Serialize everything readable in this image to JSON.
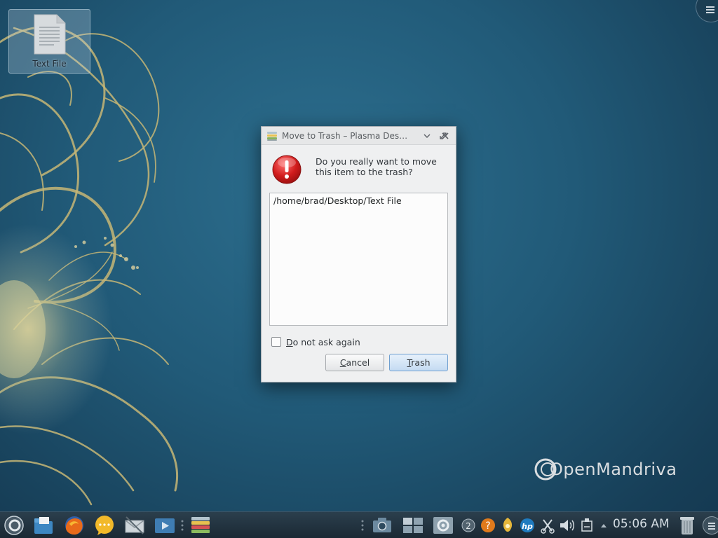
{
  "desktop": {
    "icons": [
      {
        "label": "Text File",
        "icon": "text-file-icon"
      }
    ],
    "brand": "OpenMandriva",
    "colors": {
      "background": "#215a78",
      "flourish": "#c9b97d"
    }
  },
  "dialog": {
    "title": "Move to Trash – Plasma Des…",
    "question": "Do you really want to move this item to the trash?",
    "items": [
      "/home/brad/Desktop/Text File"
    ],
    "checkbox": {
      "label_u": "D",
      "label_rest": "o not ask again",
      "checked": false
    },
    "buttons": {
      "cancel_u": "C",
      "cancel_rest": "ancel",
      "trash_u": "T",
      "trash_rest": "rash"
    },
    "titlebar_icons": [
      "chevron-down-icon",
      "maximize-icon",
      "close-icon"
    ],
    "accent": "#3daee9"
  },
  "taskbar": {
    "clock": "05:06 AM",
    "launchers": [
      "kickoff-icon",
      "file-manager-icon",
      "firefox-icon",
      "chat-icon",
      "mail-icon",
      "media-player-icon",
      "package-manager-icon"
    ],
    "tray": [
      "pager-icon",
      "window-list-icon",
      "settings-icon",
      "notifications-icon",
      "help-icon",
      "updates-icon",
      "hp-printer-icon",
      "clipboard-icon",
      "volume-icon",
      "network-icon",
      "expand-tray-icon",
      "trash-can-icon"
    ],
    "notification_count": "2"
  }
}
